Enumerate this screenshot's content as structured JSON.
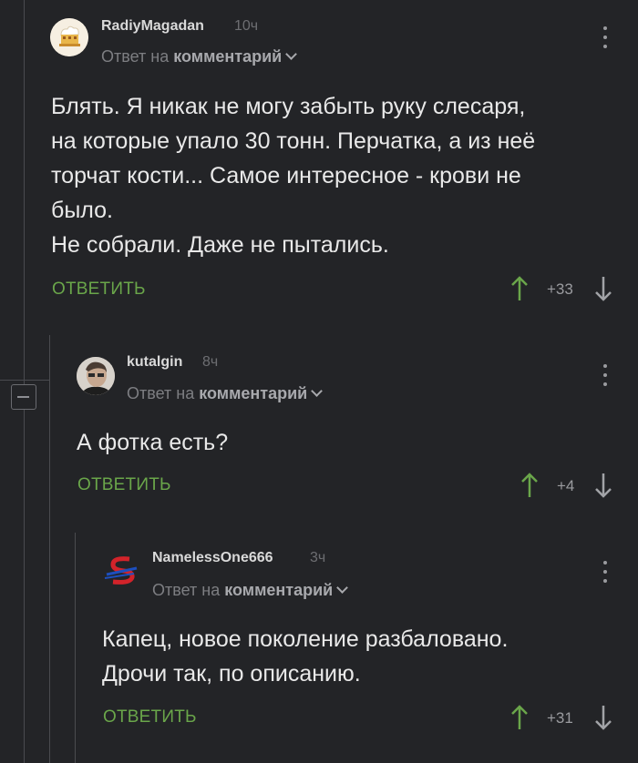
{
  "comments": [
    {
      "username": "RadiyMagadan",
      "time": "10ч",
      "reply_prefix": "Ответ на",
      "reply_target": "комментарий",
      "text": [
        "Блять. Я никак не могу забыть руку слесаря,",
        "на которые упало 30 тонн. Перчатка, а из неё",
        "торчат кости... Самое интересное - крови не",
        "было.",
        "Не собрали. Даже не пытались."
      ],
      "reply_label": "ОТВЕТИТЬ",
      "score": "+33"
    },
    {
      "username": "kutalgin",
      "time": "8ч",
      "reply_prefix": "Ответ на",
      "reply_target": "комментарий",
      "text": [
        "А фотка есть?"
      ],
      "reply_label": "ОТВЕТИТЬ",
      "score": "+4"
    },
    {
      "username": "NamelessOne666",
      "time": "3ч",
      "reply_prefix": "Ответ на",
      "reply_target": "комментарий",
      "text": [
        "Капец, новое поколение разбаловано.",
        "Дрочи так, по описанию."
      ],
      "reply_label": "ОТВЕТИТЬ",
      "score": "+31"
    }
  ],
  "colors": {
    "background": "#232427",
    "accent_green": "#6aa64a",
    "muted": "#7d7e82",
    "thread_line": "#4a4b4f"
  },
  "icons": [
    "avatar-chef",
    "avatar-person",
    "avatar-s-logo",
    "more-vertical-icon",
    "arrow-up-icon",
    "arrow-down-icon",
    "collapse-minus-icon",
    "chevron-down-icon"
  ]
}
